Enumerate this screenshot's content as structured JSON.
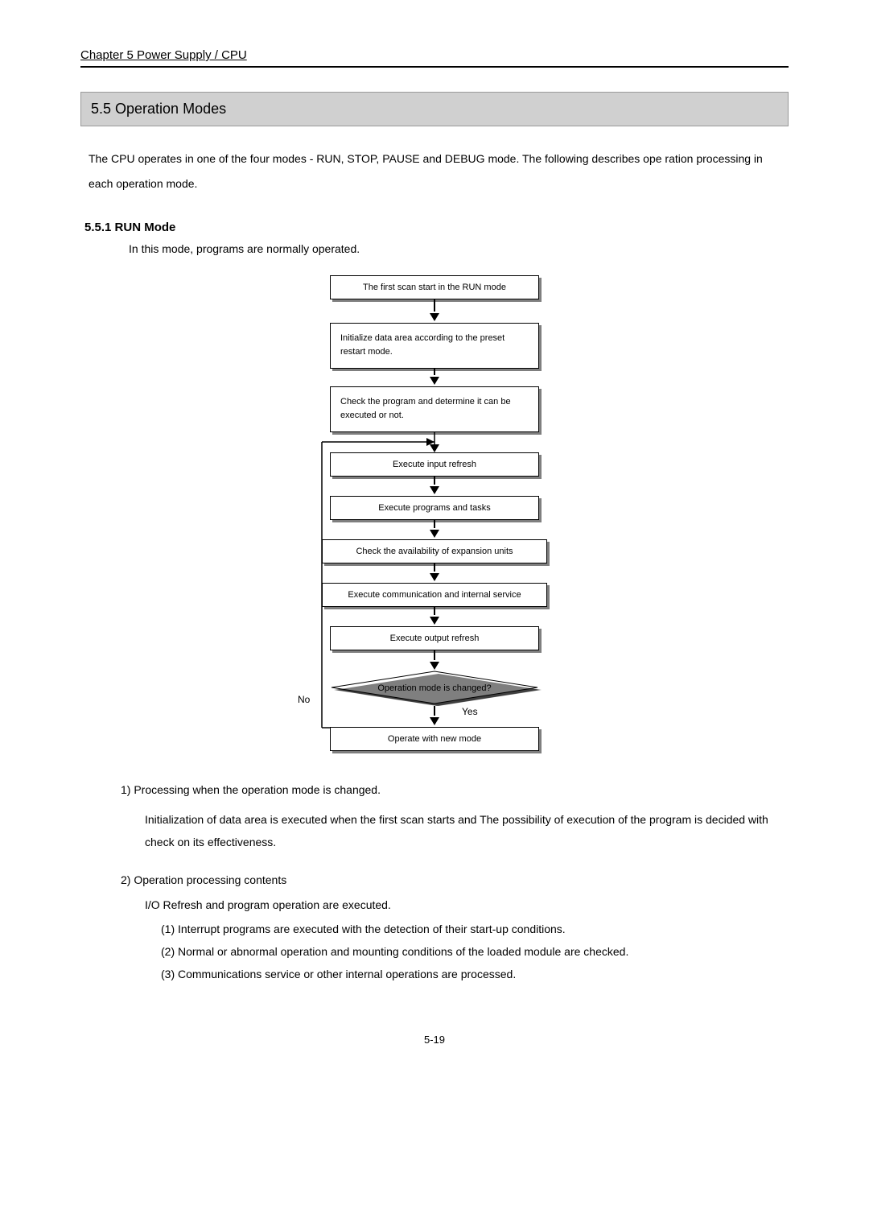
{
  "chapter_header": "Chapter 5    Power Supply / CPU",
  "section_title": "5.5    Operation  Modes",
  "intro_text": "The  CPU  operates  in  one  of  the  four  modes  -  RUN,  STOP,  PAUSE  and  DEBUG  mode.  The  following  describes  ope ration  processing  in  each  operation  mode.",
  "subsection_title": "5.5.1    RUN  Mode",
  "subsection_text": "In  this  mode,  programs  are  normally  operated.",
  "flow": {
    "box1": "The first scan start in the RUN mode",
    "box2": "Initialize  data  area  according  to  the  preset restart mode.",
    "box3": "Check  the  program  and  determine  it  can  be executed or not.",
    "box4": "Execute input refresh",
    "box5": "Execute programs and tasks",
    "box6": "Check the availability of expansion units",
    "box7": "Execute communication and internal service",
    "box8": "Execute output refresh",
    "diamond": "Operation mode is changed?",
    "box9": "Operate with new mode",
    "no_label": "No",
    "yes_label": "Yes"
  },
  "body1_title": "1)  Processing  when  the  operation  mode  is changed.",
  "body1_text": "Initialization  of  data  area  is  executed  when  the  first  scan  starts and The  possibility  of  execution  of  the  program is  decided  with  check  on  its  effectiveness.",
  "body2_title": "2) Operation  processing  contents",
  "body2_lead": "I/O Refresh  and  program  operation  are  executed.",
  "body2_items": [
    "(1) Interrupt  programs  are  executed  with  the  detection  of  their  start-up  conditions.",
    "(2) Normal  or  abnormal  operation  and  mounting  conditions  of  the  loaded  module  are  checked.",
    "(3) Communications  service  or  other  internal  operations  are  processed."
  ],
  "page_number": "5-19"
}
